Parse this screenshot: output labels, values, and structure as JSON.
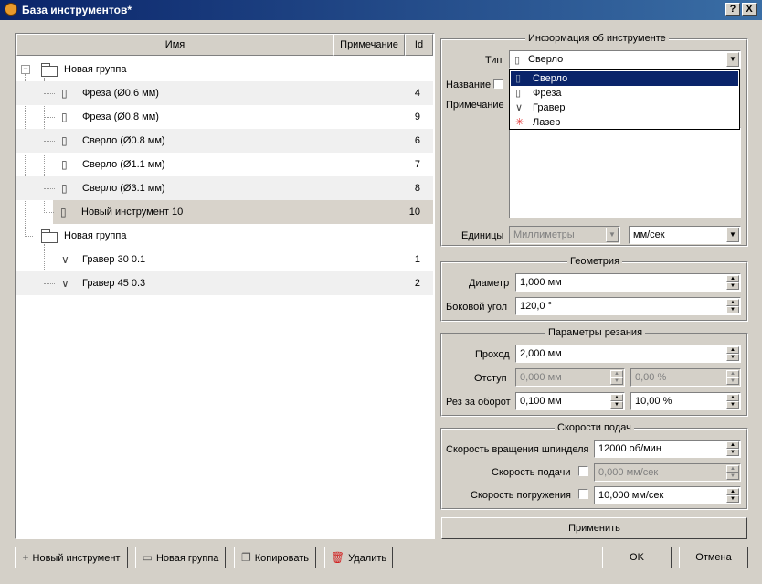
{
  "window": {
    "title": "База инструментов*",
    "help_label": "?",
    "close_label": "X"
  },
  "tree": {
    "columns": {
      "name": "Имя",
      "note": "Примечание",
      "id": "Id"
    },
    "groups": [
      {
        "label": "Новая группа",
        "expander": "−",
        "items": [
          {
            "label": "Фреза (Ø0.6 мм)",
            "id": "4",
            "icon": "mill-icon"
          },
          {
            "label": "Фреза (Ø0.8 мм)",
            "id": "9",
            "icon": "mill-icon"
          },
          {
            "label": "Сверло (Ø0.8 мм)",
            "id": "6",
            "icon": "drill-icon"
          },
          {
            "label": "Сверло (Ø1.1 мм)",
            "id": "7",
            "icon": "drill-icon"
          },
          {
            "label": "Сверло (Ø3.1 мм)",
            "id": "8",
            "icon": "drill-icon"
          },
          {
            "label": "Новый инструмент 10",
            "id": "10",
            "icon": "mill-icon",
            "selected": true
          }
        ]
      },
      {
        "label": "Новая группа",
        "expander": "−",
        "items": [
          {
            "label": "Гравер 30 0.1",
            "id": "1",
            "icon": "engraver-icon"
          },
          {
            "label": "Гравер 45 0.3",
            "id": "2",
            "icon": "engraver-icon"
          }
        ]
      }
    ]
  },
  "info": {
    "title": "Информация об инструменте",
    "type_label": "Тип",
    "type_value": "Сверло",
    "name_label": "Название",
    "note_label": "Примечание",
    "units_label": "Единицы",
    "units_value": "Миллиметры",
    "speed_units_value": "мм/сек",
    "type_options": [
      {
        "label": "Сверло",
        "icon": "drill-icon",
        "highlighted": true
      },
      {
        "label": "Фреза",
        "icon": "mill-icon"
      },
      {
        "label": "Гравер",
        "icon": "engraver-icon"
      },
      {
        "label": "Лазер",
        "icon": "laser-icon"
      }
    ]
  },
  "geometry": {
    "title": "Геометрия",
    "diameter_label": "Диаметр",
    "diameter_value": "1,000 мм",
    "angle_label": "Боковой угол",
    "angle_value": "120,0 °"
  },
  "cutting": {
    "title": "Параметры резания",
    "pass_label": "Проход",
    "pass_value": "2,000 мм",
    "offset_label": "Отступ",
    "offset_value": "0,000 мм",
    "offset_pct": "0,00 %",
    "per_rev_label": "Рез за оборот",
    "per_rev_value": "0,100 мм",
    "per_rev_pct": "10,00 %"
  },
  "feeds": {
    "title": "Скорости подач",
    "spindle_label": "Скорость вращения шпинделя",
    "spindle_value": "12000 об/мин",
    "feed_label": "Скорость подачи",
    "feed_value": "0,000 мм/сек",
    "plunge_label": "Скорость погружения",
    "plunge_value": "10,000 мм/сек"
  },
  "buttons": {
    "apply": "Применить",
    "new_tool": "Новый инструмент",
    "new_group": "Новая группа",
    "copy": "Копировать",
    "delete": "Удалить",
    "ok": "OK",
    "cancel": "Отмена"
  },
  "colors": {
    "title_bar": "#0a246a",
    "highlight": "#0a246a",
    "selected_row": "#d8d3cb",
    "delete_icon": "#d02020",
    "laser_icon": "#e02020"
  }
}
